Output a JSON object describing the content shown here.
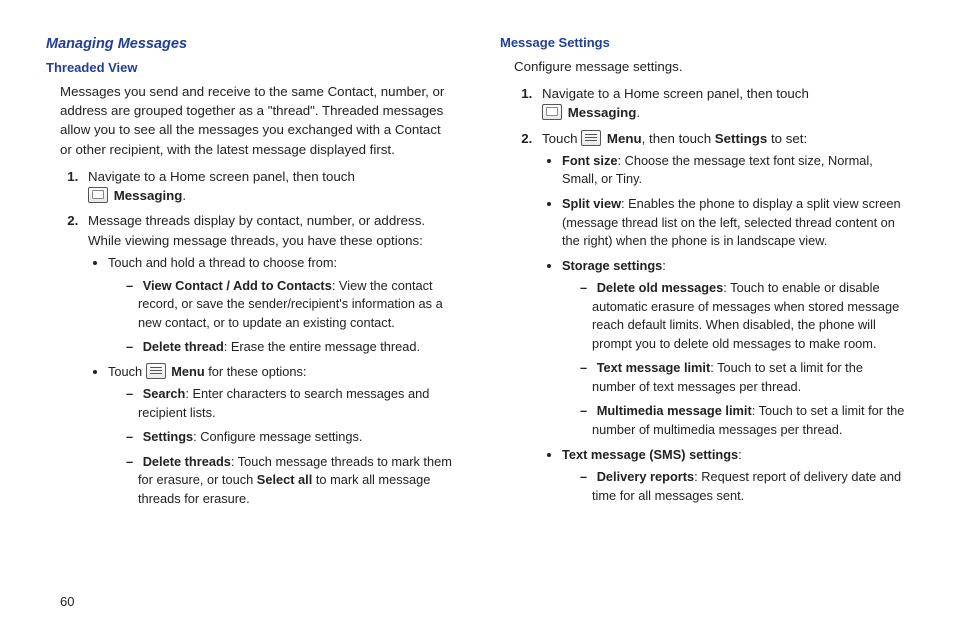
{
  "pageNumber": "60",
  "left": {
    "sectionTitle": "Managing Messages",
    "subTitle": "Threaded View",
    "intro": "Messages you send and receive to the same Contact, number, or address are grouped together as a \"thread\". Threaded messages allow you to see all the messages you exchanged with a Contact or other recipient, with the latest message displayed first.",
    "step1_a": "Navigate to a Home screen panel, then touch ",
    "step1_b": "Messaging",
    "step2_a": "Message threads display by contact, number, or address.",
    "step2_b": "While viewing message threads, you have these options:",
    "touchHold": "Touch and hold a thread to choose from:",
    "viewContact_b": "View Contact / Add to Contacts",
    "viewContact_t": ": View the contact record, or save the sender/recipient's information as a new contact, or to update an existing contact.",
    "deleteThread_b": "Delete thread",
    "deleteThread_t": ": Erase the entire message thread.",
    "touchMenu_a": "Touch ",
    "touchMenu_b": "Menu",
    "touchMenu_c": " for these options:",
    "search_b": "Search",
    "search_t": ": Enter characters to search messages and recipient lists.",
    "settings_b": "Settings",
    "settings_t": ": Configure message settings.",
    "deleteThreads_b": "Delete threads",
    "deleteThreads_t1": ": Touch message threads to mark them for erasure, or touch ",
    "deleteThreads_t2": "Select all",
    "deleteThreads_t3": " to mark all message threads for erasure."
  },
  "right": {
    "subTitle": "Message Settings",
    "intro": "Configure message settings.",
    "step1_a": "Navigate to a Home screen panel, then touch ",
    "step1_b": "Messaging",
    "step2_a": "Touch ",
    "step2_b": "Menu",
    "step2_c": ", then touch ",
    "step2_d": "Settings",
    "step2_e": " to set:",
    "fontSize_b": "Font size",
    "fontSize_t": ": Choose the message text font size, Normal, Small, or Tiny.",
    "splitView_b": "Split view",
    "splitView_t": ": Enables the phone to display a split view screen (message thread list on the left, selected thread content on the right) when the phone is in landscape view.",
    "storage_b": "Storage settings",
    "storage_t": ":",
    "deleteOld_b": "Delete old messages",
    "deleteOld_t": ": Touch to enable or disable automatic erasure of messages when stored message reach default limits. When disabled, the phone will prompt you to delete old messages to make room.",
    "textLimit_b": "Text message limit",
    "textLimit_t": ": Touch to set a limit for the number of text messages per thread.",
    "mmsLimit_b": "Multimedia message limit",
    "mmsLimit_t": ": Touch to set a limit for the number of multimedia messages per thread.",
    "sms_b": "Text message (SMS) settings",
    "sms_t": ":",
    "delivery_b": "Delivery reports",
    "delivery_t": ": Request report of delivery date and time for all messages sent."
  }
}
